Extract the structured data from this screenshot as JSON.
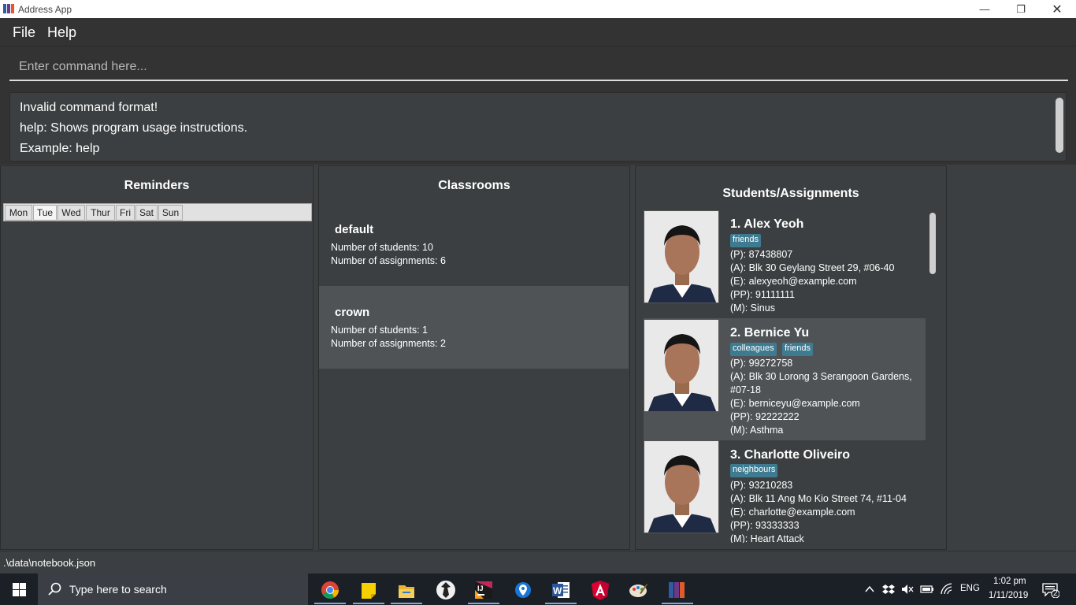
{
  "window": {
    "title": "Address App"
  },
  "menu": {
    "items": [
      "File",
      "Help"
    ]
  },
  "command": {
    "placeholder": "Enter command here..."
  },
  "result": {
    "lines": [
      "Invalid command format!",
      "help: Shows program usage instructions.",
      "Example: help"
    ]
  },
  "reminders": {
    "title": "Reminders",
    "days": [
      "Mon",
      "Tue",
      "Wed",
      "Thur",
      "Fri",
      "Sat",
      "Sun"
    ],
    "selected_day": "Tue"
  },
  "classrooms": {
    "title": "Classrooms",
    "items": [
      {
        "name": "default",
        "students": "Number of students: 10",
        "assignments": "Number of assignments: 6"
      },
      {
        "name": "crown",
        "students": "Number of students: 1",
        "assignments": "Number of assignments: 2"
      }
    ]
  },
  "students": {
    "title": "Students/Assignments",
    "items": [
      {
        "name": "1.  Alex Yeoh",
        "tags": [
          "friends"
        ],
        "phone": "(P): 87438807",
        "address": "(A): Blk 30 Geylang Street 29, #06-40",
        "email": "(E): alexyeoh@example.com",
        "parent_phone": "(PP): 91111111",
        "medical": "(M): Sinus"
      },
      {
        "name": "2.  Bernice Yu",
        "tags": [
          "colleagues",
          "friends"
        ],
        "phone": "(P): 99272758",
        "address": "(A): Blk 30 Lorong 3 Serangoon Gardens,",
        "address2": "#07-18",
        "email": "(E): berniceyu@example.com",
        "parent_phone": "(PP): 92222222",
        "medical": "(M): Asthma"
      },
      {
        "name": "3.  Charlotte Oliveiro",
        "tags": [
          "neighbours"
        ],
        "phone": "(P): 93210283",
        "address": "(A): Blk 11 Ang Mo Kio Street 74, #11-04",
        "email": "(E): charlotte@example.com",
        "parent_phone": "(PP): 93333333",
        "medical": "(M): Heart Attack"
      }
    ]
  },
  "status": {
    "path": ".\\data\\notebook.json"
  },
  "taskbar": {
    "search_placeholder": "Type here to search",
    "apps": [
      "chrome-icon",
      "sticky-notes-icon",
      "file-explorer-icon",
      "inkscape-icon",
      "intellij-icon",
      "maps-icon",
      "word-icon",
      "angular-icon",
      "paint-icon",
      "address-app-icon"
    ],
    "language": "ENG",
    "time": "1:02 pm",
    "date": "1/11/2019",
    "notification_count": "2"
  },
  "colors": {
    "panel": "#3c3f41",
    "bar": "#333333",
    "tag": "#3e7b91",
    "selected": "#4f5356",
    "taskbar": "#1b2027"
  }
}
